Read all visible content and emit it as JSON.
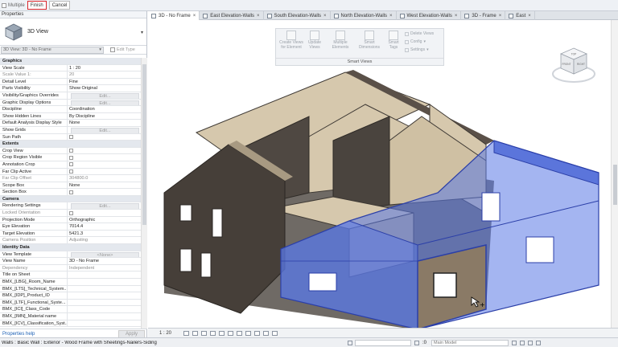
{
  "topbar": {
    "multiple_label": "Multiple",
    "finish_label": "Finish",
    "cancel_label": "Cancel"
  },
  "properties": {
    "title": "Properties",
    "type_name": "3D View",
    "instance_selector": "3D View: 3D - No Frame",
    "edit_type_label": "Edit Type",
    "help_link": "Properties help",
    "apply_label": "Apply",
    "rows": [
      {
        "kind": "section",
        "k": "Graphics"
      },
      {
        "k": "View Scale",
        "v": "1 : 20"
      },
      {
        "k": "Scale Value    1:",
        "v": "20",
        "grey": true
      },
      {
        "k": "Detail Level",
        "v": "Fine"
      },
      {
        "k": "Parts Visibility",
        "v": "Show Original"
      },
      {
        "k": "Visibility/Graphics Overrides",
        "v": "Edit...",
        "btn": true
      },
      {
        "k": "Graphic Display Options",
        "v": "Edit...",
        "btn": true
      },
      {
        "k": "Discipline",
        "v": "Coordination"
      },
      {
        "k": "Show Hidden Lines",
        "v": "By Discipline"
      },
      {
        "k": "Default Analysis Display Style",
        "v": "None"
      },
      {
        "k": "Show Grids",
        "v": "Edit...",
        "btn": true
      },
      {
        "k": "Sun Path",
        "v": "",
        "check": true
      },
      {
        "kind": "section",
        "k": "Extents"
      },
      {
        "k": "Crop View",
        "v": "",
        "check": true
      },
      {
        "k": "Crop Region Visible",
        "v": "",
        "check": true
      },
      {
        "k": "Annotation Crop",
        "v": "",
        "check": true
      },
      {
        "k": "Far Clip Active",
        "v": "",
        "check": true
      },
      {
        "k": "Far Clip Offset",
        "v": "304800.0",
        "grey": true
      },
      {
        "k": "Scope Box",
        "v": "None"
      },
      {
        "k": "Section Box",
        "v": "",
        "check": true
      },
      {
        "kind": "section",
        "k": "Camera"
      },
      {
        "k": "Rendering Settings",
        "v": "Edit...",
        "btn": true
      },
      {
        "k": "Locked Orientation",
        "v": "",
        "check": true,
        "grey": true
      },
      {
        "k": "Projection Mode",
        "v": "Orthographic"
      },
      {
        "k": "Eye Elevation",
        "v": "7014.4"
      },
      {
        "k": "Target Elevation",
        "v": "5421.3"
      },
      {
        "k": "Camera Position",
        "v": "Adjusting",
        "grey": true
      },
      {
        "kind": "section",
        "k": "Identity Data"
      },
      {
        "k": "View Template",
        "v": "<None>",
        "btn": true
      },
      {
        "k": "View Name",
        "v": "3D - No Frame"
      },
      {
        "k": "Dependency",
        "v": "Independent",
        "grey": true
      },
      {
        "k": "Title on Sheet",
        "v": ""
      },
      {
        "k": "BMX_[LBG]_Room_Name",
        "v": ""
      },
      {
        "k": "BMX_[LTS]_Technical_System...",
        "v": ""
      },
      {
        "k": "BMX_[IDP]_Product_ID",
        "v": ""
      },
      {
        "k": "BMX_[LTF]_Functional_Syste...",
        "v": ""
      },
      {
        "k": "BMX_[ICI]_Class_Code",
        "v": ""
      },
      {
        "k": "BMX_[IMN]_Material name",
        "v": ""
      },
      {
        "k": "BMX_[ICV]_Classification_Syst...",
        "v": ""
      }
    ]
  },
  "tabs": [
    {
      "label": "3D - No Frame",
      "active": true
    },
    {
      "label": "East Elevation-Walls"
    },
    {
      "label": "South Elevation-Walls"
    },
    {
      "label": "North Elevation-Walls"
    },
    {
      "label": "West Elevation-Walls"
    },
    {
      "label": "3D - Frame"
    },
    {
      "label": "East"
    }
  ],
  "smart_views": {
    "group_label": "Smart Views",
    "create_views": "Create Views for Element",
    "update_views": "Update Views",
    "multiple_elements": "Multiple Elements",
    "smart_dimensions": "Smart Dimensions",
    "smart_tags": "Smart Tags",
    "delete_views": "Delete Views",
    "config": "Config",
    "settings": "Settings"
  },
  "viewcube": {
    "front": "FRONT",
    "right": "RIGHT",
    "top": "TOP"
  },
  "view_bar": {
    "scale": "1 : 20"
  },
  "status": {
    "text": "Walls : Basic Wall : Exterior - Wood Frame with Sheetings-Nailers-Siding",
    "model": "Main Model",
    "zero": ":0"
  },
  "colors": {
    "selection": "#5a78e6",
    "wall_face": "#d6c8ad",
    "wall_dark": "#5a5048",
    "accent": "#1a5fb4"
  }
}
